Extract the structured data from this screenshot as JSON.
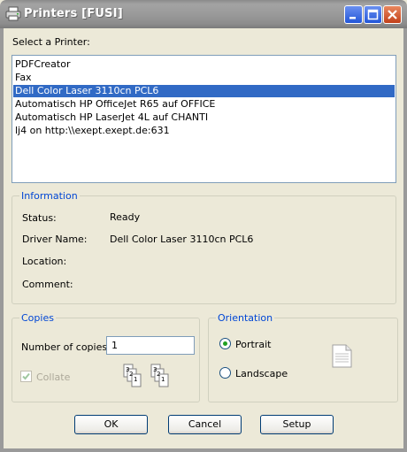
{
  "window": {
    "title": "Printers  [FUSI]"
  },
  "printer_list": {
    "label": "Select a Printer:",
    "items": [
      "PDFCreator",
      "Fax",
      "Dell Color Laser 3110cn PCL6",
      "Automatisch HP OfficeJet R65 auf OFFICE",
      "Automatisch HP LaserJet 4L auf CHANTI",
      "lj4 on http:\\\\exept.exept.de:631"
    ],
    "selected": "Dell Color Laser 3110cn PCL6"
  },
  "information": {
    "legend": "Information",
    "status_label": "Status:",
    "status_value": "Ready",
    "driver_label": "Driver Name:",
    "driver_value": "Dell Color Laser 3110cn PCL6",
    "location_label": "Location:",
    "location_value": "",
    "comment_label": "Comment:",
    "comment_value": ""
  },
  "copies": {
    "legend": "Copies",
    "number_label": "Number of copies:",
    "number_value": "1",
    "collate_label": "Collate",
    "collate_checked": true,
    "collate_enabled": false
  },
  "orientation": {
    "legend": "Orientation",
    "portrait_label": "Portrait",
    "landscape_label": "Landscape",
    "selected": "Portrait"
  },
  "buttons": {
    "ok": "OK",
    "cancel": "Cancel",
    "setup": "Setup"
  },
  "colors": {
    "selection": "#316ac5",
    "group_legend": "#0046d5",
    "dialog_bg": "#ece9d8"
  }
}
